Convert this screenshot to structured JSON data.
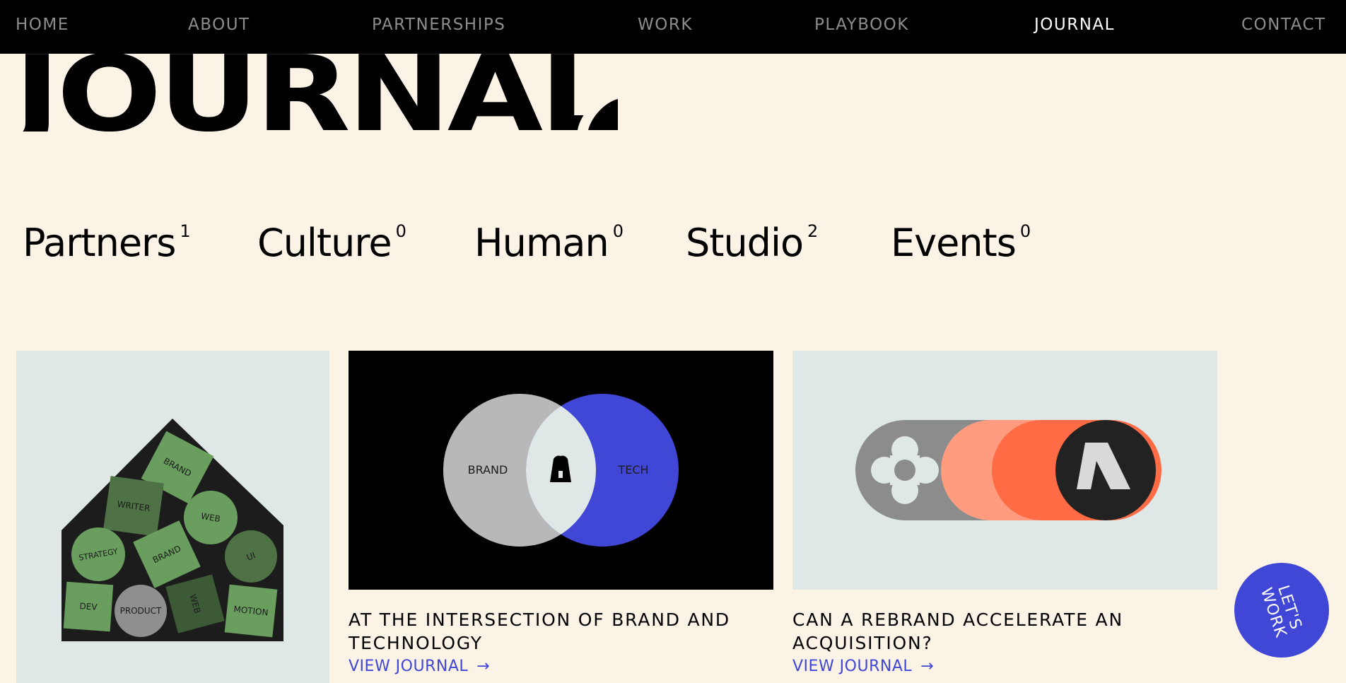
{
  "nav": {
    "items": [
      {
        "label": "HOME",
        "active": false
      },
      {
        "label": "ABOUT",
        "active": false
      },
      {
        "label": "PARTNERSHIPS",
        "active": false
      },
      {
        "label": "WORK",
        "active": false
      },
      {
        "label": "PLAYBOOK",
        "active": false
      },
      {
        "label": "JOURNAL",
        "active": true
      },
      {
        "label": "CONTACT",
        "active": false
      }
    ]
  },
  "page": {
    "title": "JOURNAL"
  },
  "categories": [
    {
      "label": "Partners",
      "count": "1"
    },
    {
      "label": "Culture",
      "count": "0"
    },
    {
      "label": "Human",
      "count": "0"
    },
    {
      "label": "Studio",
      "count": "2"
    },
    {
      "label": "Events",
      "count": "0"
    }
  ],
  "cards": [
    {
      "image_labels": [
        "BRAND",
        "WRITER",
        "WEB",
        "STRATEGY",
        "BRAND",
        "UI",
        "DEV",
        "PRODUCT",
        "WEB",
        "MOTION"
      ]
    },
    {
      "image_labels": [
        "BRAND",
        "TECH"
      ],
      "title_line1": "AT THE INTERSECTION OF BRAND AND",
      "title_line2": "TECHNOLOGY",
      "link": "VIEW JOURNAL",
      "arrow": "→"
    },
    {
      "title_line1": "CAN A REBRAND ACCELERATE AN",
      "title_line2": "ACQUISITION?",
      "link": "VIEW JOURNAL",
      "arrow": "→"
    }
  ],
  "cta": {
    "label_line1": "LET'S",
    "label_line2": "WORK"
  },
  "colors": {
    "background": "#FBF3E6",
    "nav_bg": "#000000",
    "accent_blue": "#4047D6",
    "card_bg": "#DFE7E7",
    "house_dark": "#1C1C1C",
    "tile_green": "#6A9E5F",
    "salmon": "#FF9C80",
    "orange": "#FF6B45",
    "grey": "#8C8C8C"
  }
}
